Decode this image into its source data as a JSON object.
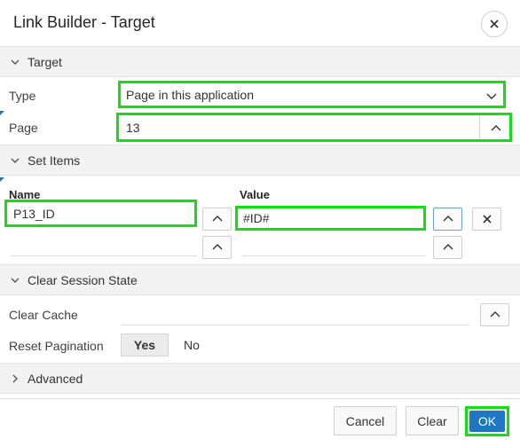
{
  "dialog": {
    "title": "Link Builder - Target"
  },
  "sections": {
    "target": "Target",
    "set_items": "Set Items",
    "clear_session": "Clear Session State",
    "advanced": "Advanced"
  },
  "target": {
    "type_label": "Type",
    "type_value": "Page in this application",
    "page_label": "Page",
    "page_value": "13"
  },
  "set_items": {
    "name_header": "Name",
    "value_header": "Value",
    "rows": [
      {
        "name": "P13_ID",
        "value": "#ID#"
      },
      {
        "name": "",
        "value": ""
      }
    ]
  },
  "clear_session": {
    "clear_cache_label": "Clear Cache",
    "clear_cache_value": "",
    "reset_pagination_label": "Reset Pagination",
    "yes": "Yes",
    "no": "No",
    "selected": "Yes"
  },
  "footer": {
    "cancel": "Cancel",
    "clear": "Clear",
    "ok": "OK"
  },
  "colors": {
    "accent": "#1f77c2",
    "highlight": "#10e010"
  },
  "icons": [
    "close-icon",
    "chevron-down-icon",
    "chevron-right-icon",
    "chevron-up-icon"
  ]
}
